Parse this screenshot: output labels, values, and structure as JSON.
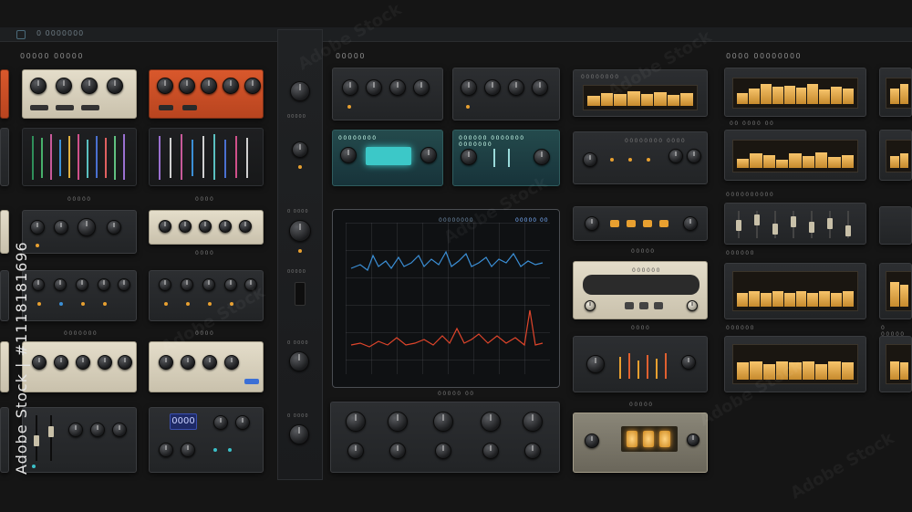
{
  "topbar": {
    "title": "0 0000000",
    "menu_icon": "panel-icon"
  },
  "columns": {
    "col1_title": "00000 00000",
    "col3_title": "00000",
    "col5_title": "0000  00000000"
  },
  "captions": {
    "eq_title": "00000",
    "eq2_title": "0000",
    "mid_caption": "0000",
    "row4_caption": "0000000",
    "row4_caption2": "0000",
    "spectrum_footer": "00000 00",
    "amp_caption": "00000",
    "amp_caption2": "0000",
    "tube_caption": "00000",
    "meters_caption1": "00 0000 00",
    "meters_caption2": "0000000000",
    "meters_caption3": "000000",
    "meters_caption4": "000000",
    "meters_caption5": "0 00000"
  },
  "panels": {
    "teal1_label": "00000000",
    "teal2_label": "000000  0000000  0000000",
    "dark_label": "00000000  0000",
    "cream_label": "000000",
    "orange_label": "00000000"
  },
  "spectrum": {
    "title": "00000000",
    "badge": "00000 00"
  },
  "strip": {
    "label1": "00000",
    "label2": "0 0000",
    "label3": "00000",
    "label4": "0 0000",
    "label5": "0 0000"
  },
  "display": {
    "value": "0000"
  },
  "watermark": {
    "stock_id": "Adobe Stock | #1118181696",
    "brand": "Adobe Stock"
  },
  "colors": {
    "background": "#151515",
    "orange_panel": "#d9582c",
    "cream_panel": "#e4ddca",
    "teal_panel": "#244a4c",
    "meter_amber": "#f7c46b",
    "spectrum_blue": "#3b8fd6",
    "spectrum_red": "#e0452b"
  }
}
